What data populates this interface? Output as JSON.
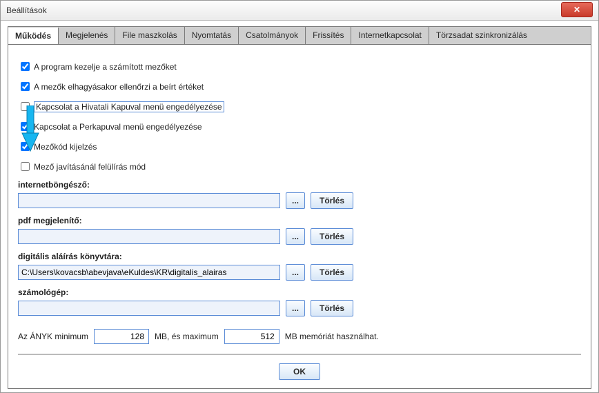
{
  "window": {
    "title": "Beállítások"
  },
  "tabs": [
    {
      "id": "mukodes",
      "label": "Működés",
      "active": true
    },
    {
      "id": "megjelenes",
      "label": "Megjelenés"
    },
    {
      "id": "filemask",
      "label": "File maszkolás"
    },
    {
      "id": "nyomtatas",
      "label": "Nyomtatás"
    },
    {
      "id": "csatolmanyok",
      "label": "Csatolmányok"
    },
    {
      "id": "frissites",
      "label": "Frissítés"
    },
    {
      "id": "internet",
      "label": "Internetkapcsolat"
    },
    {
      "id": "torzsadat",
      "label": "Törzsadat szinkronizálás"
    }
  ],
  "checks": {
    "szamitott": {
      "label": "A program kezelje a számított mezőket",
      "checked": true
    },
    "ellenorzi": {
      "label": "A mezők elhagyásakor ellenőrzi a beírt értéket",
      "checked": true
    },
    "hivatali": {
      "label": "Kapcsolat a Hivatali Kapuval menü engedélyezése",
      "checked": false,
      "highlight": true
    },
    "perkapu": {
      "label": "Kapcsolat a Perkapuval menü engedélyezése",
      "checked": true
    },
    "mezokod": {
      "label": "Mezőkód kijelzés",
      "checked": true
    },
    "felul": {
      "label": "Mező javításánál felülírás mód",
      "checked": false
    }
  },
  "paths": {
    "browser": {
      "label": "internetböngésző:",
      "value": ""
    },
    "pdf": {
      "label": "pdf megjelenítő:",
      "value": ""
    },
    "signature": {
      "label": "digitális aláírás könyvtára:",
      "value": "C:\\Users\\kovacsb\\abevjava\\eKuldes\\KR\\digitalis_alairas"
    },
    "calc": {
      "label": "számológép:",
      "value": ""
    }
  },
  "buttons": {
    "browse": "...",
    "delete": "Törlés",
    "ok": "OK"
  },
  "memory": {
    "prefix": "Az ÁNYK minimum",
    "min": "128",
    "middle": "MB, és maximum",
    "max": "512",
    "suffix": "MB memóriát használhat."
  }
}
